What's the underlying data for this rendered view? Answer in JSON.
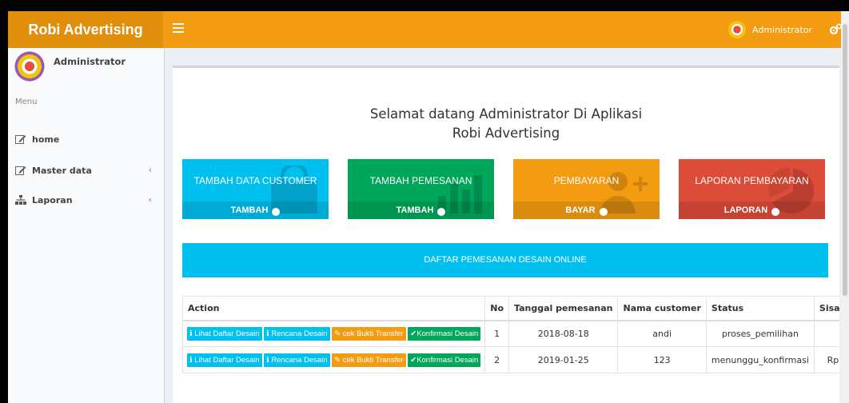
{
  "header": {
    "app_title": "Robi Advertising",
    "user_label": "Administrator",
    "colors": {
      "primary": "#f39c12",
      "logo_bg": "#e08e0b"
    }
  },
  "sidebar": {
    "user_name": "Administrator",
    "menu_header": "Menu",
    "items": [
      {
        "label": "home",
        "icon": "edit-icon"
      },
      {
        "label": "Master data",
        "icon": "edit-icon",
        "chevron": "‹"
      },
      {
        "label": "Laporan",
        "icon": "sitemap-icon",
        "chevron": "‹"
      }
    ]
  },
  "main": {
    "welcome_line1": "Selamat datang Administrator Di Aplikasi",
    "welcome_line2": "Robi Advertising",
    "tiles": [
      {
        "title": "TAMBAH DATA CUSTOMER",
        "link": "TAMBAH",
        "color": "#00c0ef",
        "icon": "shopping-bag-icon"
      },
      {
        "title": "TAMBAH PEMESANAN",
        "link": "TAMBAH",
        "color": "#00a65a",
        "icon": "bar-chart-icon"
      },
      {
        "title": "PEMBAYARAN",
        "link": "BAYAR",
        "color": "#f39c12",
        "icon": "user-plus-icon"
      },
      {
        "title": "LAPORAN PEMBAYARAN",
        "link": "LAPORAN",
        "color": "#dd4b39",
        "icon": "pie-chart-icon"
      }
    ],
    "banner": "DAFTAR PEMESANAN DESAIN ONLINE",
    "table": {
      "headers": [
        "Action",
        "No",
        "Tanggal pemesanan",
        "Nama customer",
        "Status",
        "Sisa P"
      ],
      "action_buttons": [
        "Lihat Daftar Desain",
        "Rencana Desain",
        "cek Bukti Transfer",
        "Konfirmasi Desain"
      ],
      "rows": [
        {
          "no": "1",
          "tanggal": "2018-08-18",
          "customer": "andi",
          "status": "proses_pemilihan",
          "sisa": ""
        },
        {
          "no": "2",
          "tanggal": "2019-01-25",
          "customer": "123",
          "status": "menunggu_konfirmasi",
          "sisa": "Rp."
        }
      ]
    }
  }
}
